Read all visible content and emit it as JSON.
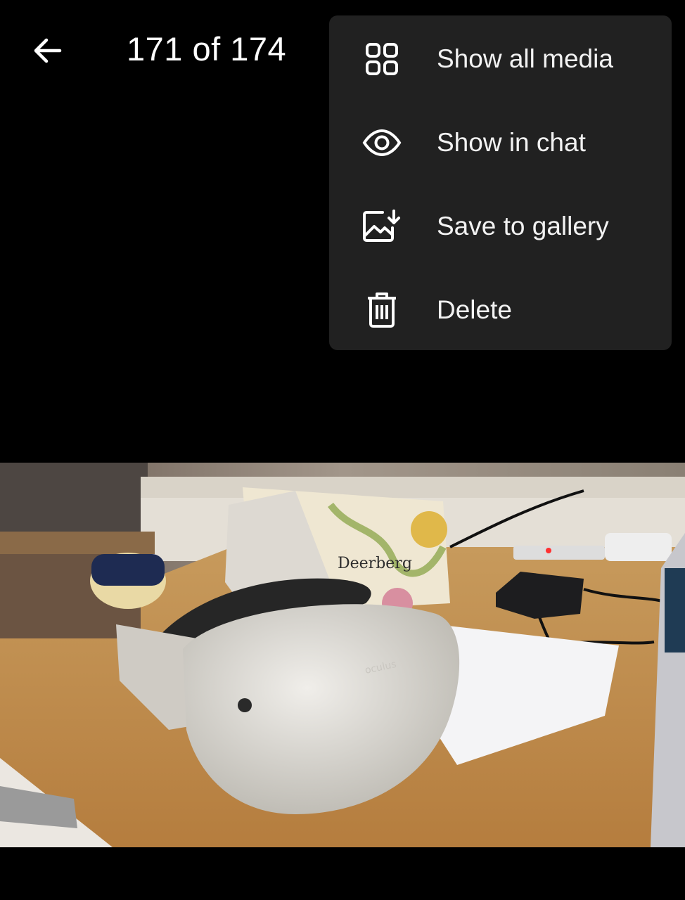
{
  "header": {
    "counter": "171 of 174",
    "back_icon": "arrow-left-icon",
    "share_icon": "share-icon",
    "more_icon": "more-vertical-icon"
  },
  "menu": {
    "items": [
      {
        "label": "Show all media",
        "icon": "grid-icon"
      },
      {
        "label": "Show in chat",
        "icon": "eye-icon"
      },
      {
        "label": "Save to gallery",
        "icon": "save-image-icon"
      },
      {
        "label": "Delete",
        "icon": "trash-icon"
      }
    ]
  },
  "photo": {
    "bag_brand": "Deerberg",
    "headset_brand": "oculus"
  },
  "colors": {
    "background": "#000000",
    "menu_background": "#212121",
    "text": "#ffffff"
  }
}
